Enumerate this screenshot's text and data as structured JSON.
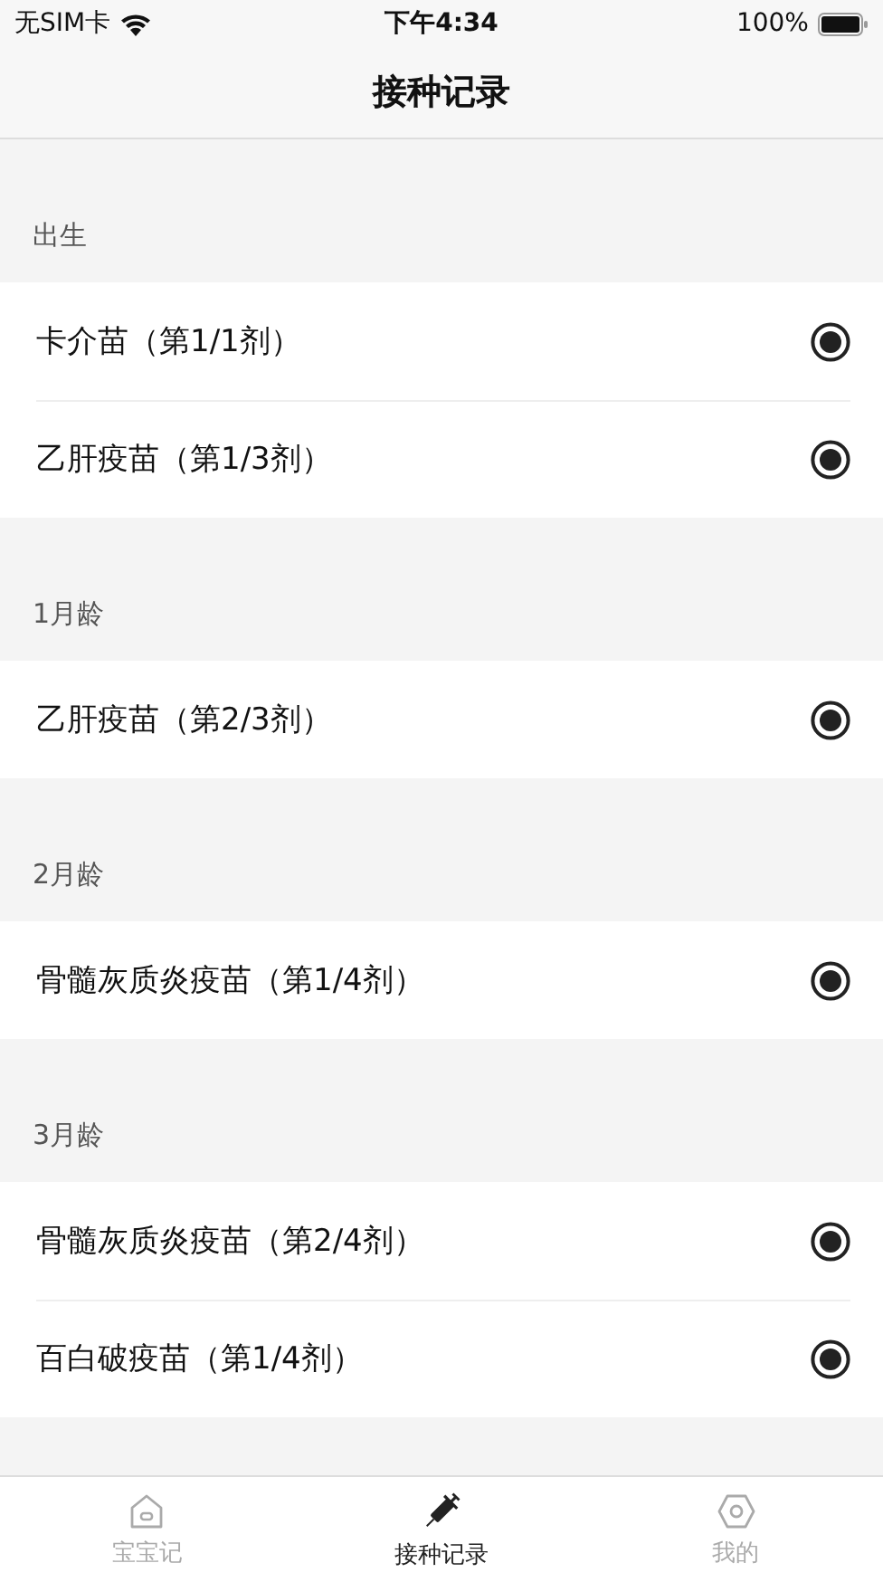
{
  "status_bar": {
    "carrier": "无SIM卡",
    "time": "下午4:34",
    "battery": "100%"
  },
  "nav_bar": {
    "title": "接种记录"
  },
  "sections": [
    {
      "title": "出生",
      "items": [
        {
          "label": "卡介苗（第1/1剂）",
          "checked": true
        },
        {
          "label": "乙肝疫苗（第1/3剂）",
          "checked": true
        }
      ]
    },
    {
      "title": "1月龄",
      "items": [
        {
          "label": "乙肝疫苗（第2/3剂）",
          "checked": true
        }
      ]
    },
    {
      "title": "2月龄",
      "items": [
        {
          "label": "骨髓灰质炎疫苗（第1/4剂）",
          "checked": true
        }
      ]
    },
    {
      "title": "3月龄",
      "items": [
        {
          "label": "骨髓灰质炎疫苗（第2/4剂）",
          "checked": true
        },
        {
          "label": "百白破疫苗（第1/4剂）",
          "checked": true
        }
      ]
    }
  ],
  "tab_bar": [
    {
      "label": "宝宝记",
      "kind": "home",
      "selected": false
    },
    {
      "label": "接种记录",
      "kind": "syringe",
      "selected": true
    },
    {
      "label": "我的",
      "kind": "profile",
      "selected": false
    }
  ]
}
